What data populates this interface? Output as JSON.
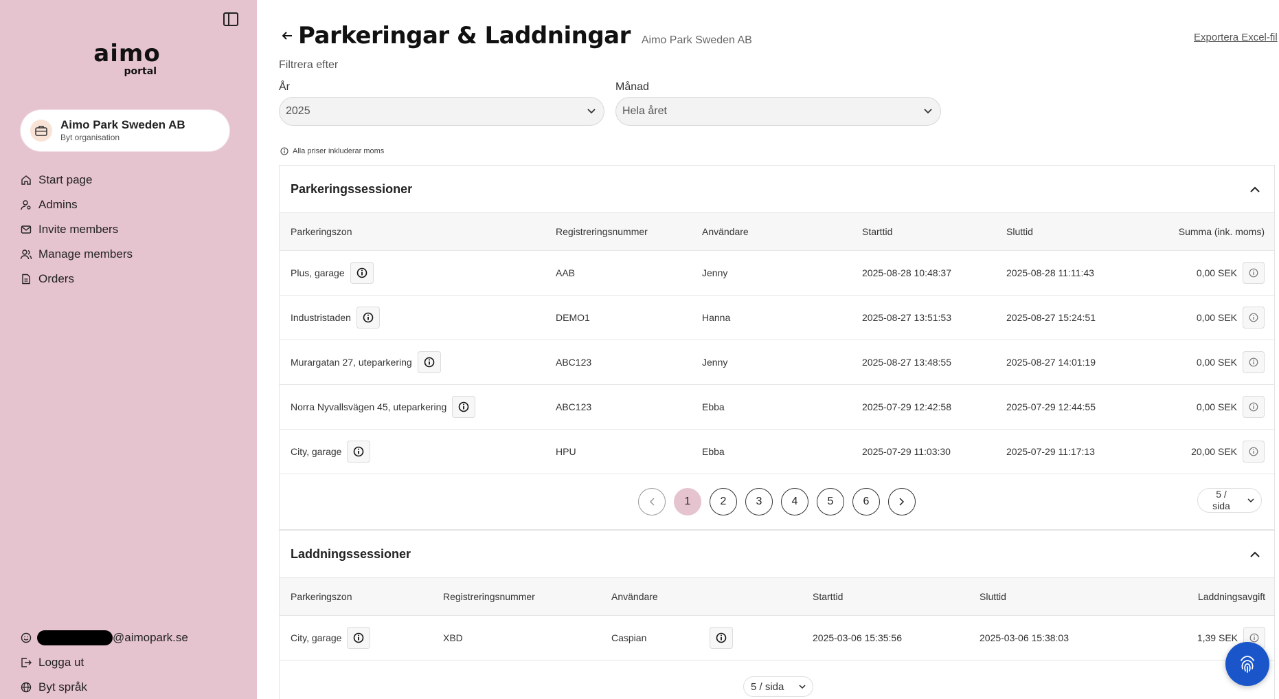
{
  "sidebar": {
    "logo": {
      "main": "aimo",
      "sub": "portal"
    },
    "org": {
      "name": "Aimo Park Sweden AB",
      "switch_label": "Byt organisation"
    },
    "nav": [
      {
        "label": "Start page",
        "icon": "home-icon"
      },
      {
        "label": "Admins",
        "icon": "admin-icon"
      },
      {
        "label": "Invite members",
        "icon": "mail-icon"
      },
      {
        "label": "Manage members",
        "icon": "users-icon"
      },
      {
        "label": "Orders",
        "icon": "document-icon"
      }
    ],
    "user_email_domain": "@aimopark.se",
    "logout_label": "Logga ut",
    "language_label": "Byt språk"
  },
  "header": {
    "title": "Parkeringar & Laddningar",
    "org": "Aimo Park Sweden AB",
    "export_label": "Exportera Excel-fil"
  },
  "filters": {
    "label": "Filtrera efter",
    "year_label": "År",
    "year_value": "2025",
    "month_label": "Månad",
    "month_value": "Hela året",
    "vat_note": "Alla priser inkluderar moms"
  },
  "parking": {
    "title": "Parkeringssessioner",
    "columns": [
      "Parkeringszon",
      "Registreringsnummer",
      "Användare",
      "Starttid",
      "Sluttid",
      "Summa (ink. moms)"
    ],
    "rows": [
      {
        "zone": "Plus, garage",
        "reg": "AAB",
        "user": "Jenny",
        "start": "2025-08-28 10:48:37",
        "end": "2025-08-28 11:11:43",
        "sum": "0,00 SEK"
      },
      {
        "zone": "Industristaden",
        "reg": "DEMO1",
        "user": "Hanna",
        "start": "2025-08-27 13:51:53",
        "end": "2025-08-27 15:24:51",
        "sum": "0,00 SEK"
      },
      {
        "zone": "Murargatan 27, uteparkering",
        "reg": "ABC123",
        "user": "Jenny",
        "start": "2025-08-27 13:48:55",
        "end": "2025-08-27 14:01:19",
        "sum": "0,00 SEK"
      },
      {
        "zone": "Norra Nyvallsvägen 45, uteparkering",
        "reg": "ABC123",
        "user": "Ebba",
        "start": "2025-07-29 12:42:58",
        "end": "2025-07-29 12:44:55",
        "sum": "0,00 SEK"
      },
      {
        "zone": "City, garage",
        "reg": "HPU",
        "user": "Ebba",
        "start": "2025-07-29 11:03:30",
        "end": "2025-07-29 11:17:13",
        "sum": "20,00 SEK"
      }
    ],
    "pages": [
      "1",
      "2",
      "3",
      "4",
      "5",
      "6"
    ],
    "current_page": "1",
    "per_page": "5 / sida"
  },
  "charging": {
    "title": "Laddningssessioner",
    "columns": [
      "Parkeringszon",
      "Registreringsnummer",
      "Användare",
      "Starttid",
      "Sluttid",
      "Laddningsavgift"
    ],
    "rows": [
      {
        "zone": "City, garage",
        "reg": "XBD",
        "user": "Caspian",
        "start": "2025-03-06 15:35:56",
        "end": "2025-03-06 15:38:03",
        "fee": "1,39 SEK"
      }
    ],
    "per_page": "5 / sida"
  },
  "colors": {
    "sidebar_bg": "#e6c4cf",
    "accent": "#e6c4cf",
    "chat_button": "#1a56c9"
  }
}
